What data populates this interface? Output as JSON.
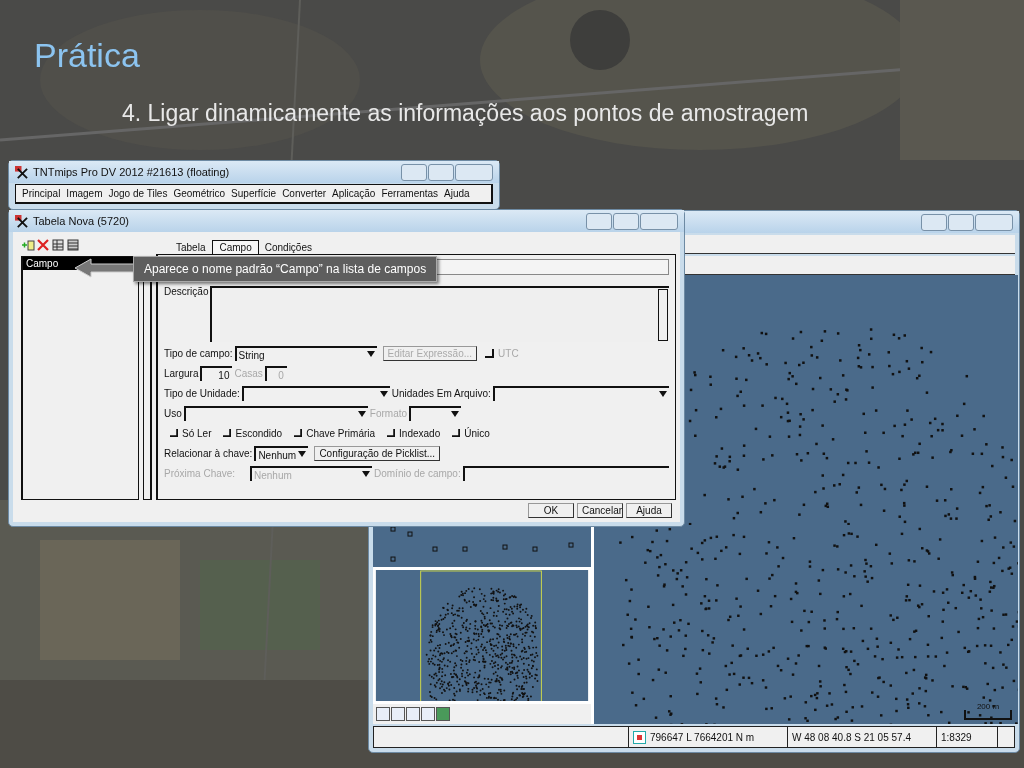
{
  "slide": {
    "title": "Prática",
    "subtitle": "4. Ligar dinamicamente as informações aos pontos de amostragem"
  },
  "main_window": {
    "title": "TNTmips Pro DV 2012  #21613 (floating)",
    "menu": [
      "Principal",
      "Imagem",
      "Jogo de Tiles",
      "Geométrico",
      "Superfície",
      "Converter",
      "Aplicação",
      "Ferramentas",
      "Ajuda"
    ]
  },
  "dialog": {
    "title": "Tabela Nova (5720)",
    "fields_list": [
      {
        "label": "Campo",
        "selected": true
      }
    ],
    "tabs": [
      {
        "label": "Tabela",
        "selected": false
      },
      {
        "label": "Campo",
        "selected": true
      },
      {
        "label": "Condições",
        "selected": false
      }
    ],
    "callout": "Aparece o nome padrão “Campo” na lista de campos",
    "description_label": "Descrição",
    "field_type": {
      "label": "Tipo de campo:",
      "value": "String"
    },
    "edit_expression": {
      "label": "Editar Expressão...",
      "disabled": true
    },
    "utc": {
      "label": "UTC",
      "checked": false,
      "disabled": true
    },
    "width": {
      "label": "Largura",
      "value": "10"
    },
    "places": {
      "label": "Casas",
      "value": "0",
      "disabled": true
    },
    "unit_type": {
      "label": "Tipo de Unidade:"
    },
    "file_units": {
      "label": "Unidades Em Arquivo:"
    },
    "usage": {
      "label": "Uso"
    },
    "format": {
      "label": "Formato",
      "disabled": true
    },
    "options": [
      {
        "label": "Só Ler",
        "checked": false
      },
      {
        "label": "Escondido",
        "checked": false
      },
      {
        "label": "Chave Primária",
        "checked": false
      },
      {
        "label": "Indexado",
        "checked": false
      },
      {
        "label": "Único",
        "checked": false
      }
    ],
    "relate_key": {
      "label": "Relacionar à chave:",
      "value": "Nenhum"
    },
    "picklist_button": "Configuração de Picklist...",
    "next_key": {
      "label": "Próxima Chave:",
      "value": "Nenhum",
      "disabled": true
    },
    "domain": {
      "label": "Domínio de campo:",
      "disabled": true
    },
    "buttons": [
      "OK",
      "Cancelar",
      "Ajuda"
    ]
  },
  "viewer": {
    "scale_bar": "200 m",
    "status": {
      "projected": "796647 L  7664201 N m",
      "geographic": "W 48 08 40.8  S 21 05 57.4",
      "scale": "1:8329"
    }
  }
}
